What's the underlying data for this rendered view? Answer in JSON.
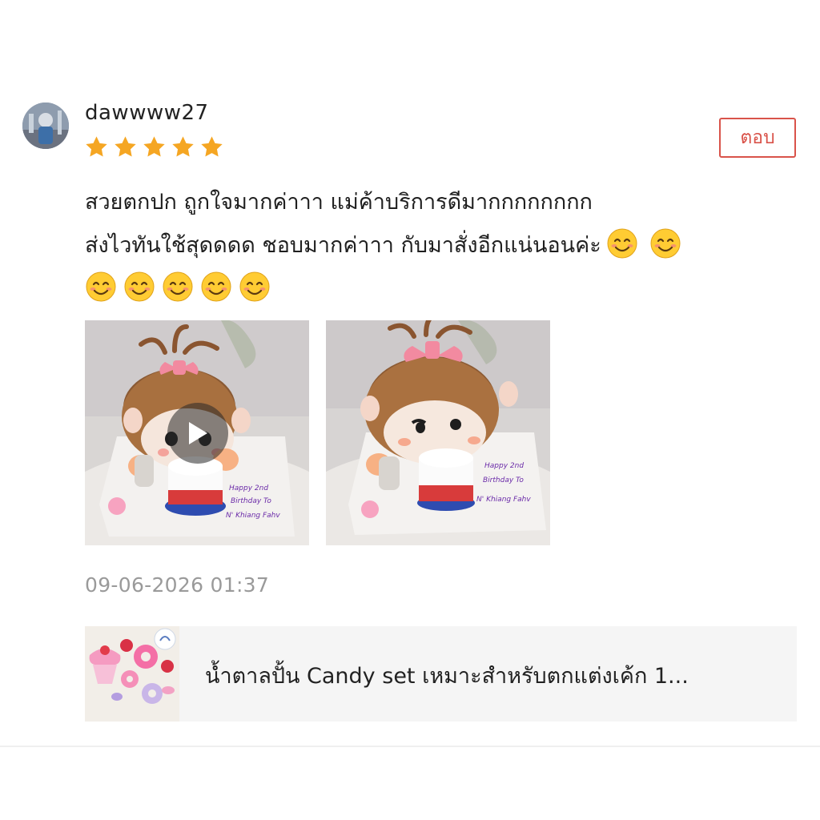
{
  "review": {
    "username": "dawwww27",
    "rating": 5,
    "reply_label": "ตอบ",
    "text_lines": [
      "สวยตกปก ถูกใจมากค่าาา แม่ค้าบริการดีมากกกกกกกก",
      "ส่งไวทันใช้สุดดดด ชอบมากค่าาา กับมาสั่งอีกแน่นอนค่ะ"
    ],
    "emoji_name": "smiling-face-emoji",
    "photos": [
      {
        "type": "video",
        "cake_text": [
          "Happy 2nd",
          "Birthday To",
          "N' Khiang Fahv"
        ]
      },
      {
        "type": "image",
        "cake_text": [
          "Happy 2nd",
          "Birthday To",
          "N' Khiang Fahv"
        ]
      }
    ],
    "timestamp": "09-06-2026 01:37"
  },
  "product": {
    "title": "น้ำตาลปั้น Candy set เหมาะสำหรับตกแต่งเค้ก 1..."
  },
  "colors": {
    "star": "#f5a623",
    "reply_accent": "#d9534a",
    "timestamp": "#9a9a9a",
    "product_card_bg": "#f5f5f5"
  }
}
